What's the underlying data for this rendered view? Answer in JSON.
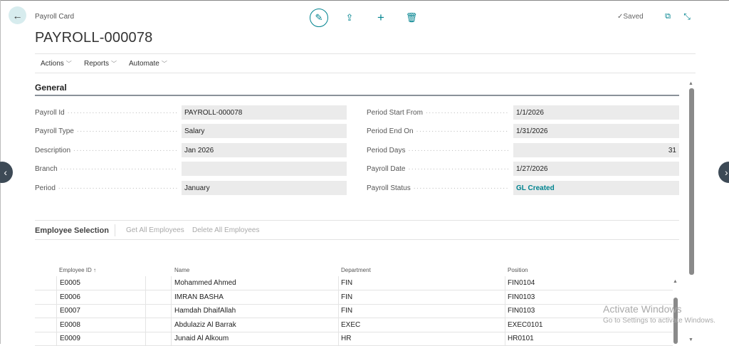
{
  "header": {
    "breadcrumb": "Payroll Card",
    "title": "PAYROLL-000078",
    "saved": "Saved"
  },
  "menu": [
    "Actions",
    "Reports",
    "Automate"
  ],
  "general": {
    "heading": "General",
    "left": [
      {
        "label": "Payroll Id",
        "value": "PAYROLL-000078"
      },
      {
        "label": "Payroll Type",
        "value": "Salary"
      },
      {
        "label": "Description",
        "value": "Jan 2026"
      },
      {
        "label": "Branch",
        "value": ""
      },
      {
        "label": "Period",
        "value": "January"
      }
    ],
    "right": [
      {
        "label": "Period Start From",
        "value": "1/1/2026"
      },
      {
        "label": "Period End On",
        "value": "1/31/2026"
      },
      {
        "label": "Period Days",
        "value": "31"
      },
      {
        "label": "Payroll Date",
        "value": "1/27/2026"
      },
      {
        "label": "Payroll Status",
        "value": "GL Created"
      }
    ],
    "status_color": "#00838f"
  },
  "employees": {
    "heading": "Employee Selection",
    "actions": [
      "Get All Employees",
      "Delete All Employees"
    ],
    "columns": [
      "Employee ID ↑",
      "Name",
      "Department",
      "Position"
    ],
    "rows": [
      [
        "E0005",
        "Mohammed Ahmed",
        "FIN",
        "FIN0104"
      ],
      [
        "E0006",
        "IMRAN BASHA",
        "FIN",
        "FIN0103"
      ],
      [
        "E0007",
        "Hamdah DhaifAllah",
        "FIN",
        "FIN0103"
      ],
      [
        "E0008",
        "Abdulaziz Al Barrak",
        "EXEC",
        "EXEC0101"
      ],
      [
        "E0009",
        "Junaid Al Alkoum",
        "HR",
        "HR0101"
      ]
    ]
  },
  "watermark": {
    "title": "Activate Windows",
    "subtitle": "Go to Settings to activate Windows."
  },
  "accent": "#00838f"
}
